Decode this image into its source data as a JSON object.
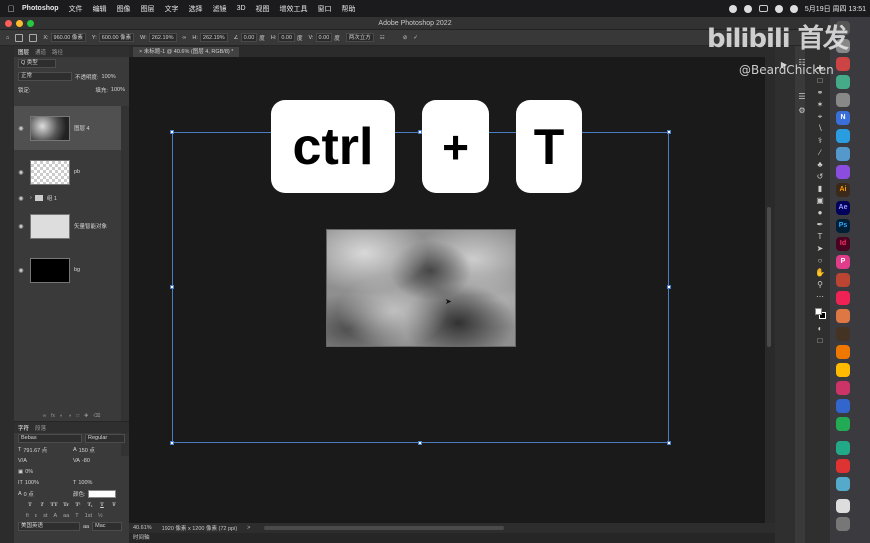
{
  "menubar": {
    "items": [
      "Photoshop",
      "文件",
      "编辑",
      "图像",
      "图层",
      "文字",
      "选择",
      "滤镜",
      "3D",
      "视图",
      "增效工具",
      "窗口",
      "帮助"
    ],
    "datetime": "5月19日 周四  13:51"
  },
  "window": {
    "title": "Adobe Photoshop 2022"
  },
  "options": {
    "x_label": "X:",
    "x_value": "960.00 像素",
    "y_label": "Y:",
    "y_value": "600.00 像素",
    "w_label": "W:",
    "w_value": "262.19%",
    "h_label": "H:",
    "h_value": "262.19%",
    "rotate_value": "0.00",
    "rotate_unit": "度",
    "hskew_label": "H:",
    "hskew_value": "0.00",
    "hskew_unit": "度",
    "vskew_label": "V:",
    "vskew_value": "0.00",
    "vskew_unit": "度",
    "interpolation": "两次立方"
  },
  "document_tab": {
    "label": "未标题-1 @ 40.6% (图层 4, RGB/8) *"
  },
  "layers_panel": {
    "tabs": [
      "图层",
      "通道",
      "路径"
    ],
    "filter_label": "Q 类型",
    "blend_mode": "正常",
    "opacity_label": "不透明度:",
    "opacity_value": "100%",
    "lock_label": "锁定:",
    "fill_label": "填充:",
    "fill_value": "100%",
    "layers": [
      {
        "name": "图层 4"
      },
      {
        "name": "pb"
      },
      {
        "name": "组 1"
      },
      {
        "name": "矢量智能对象"
      },
      {
        "name": "bg"
      }
    ]
  },
  "character_panel": {
    "tabs": [
      "字符",
      "段落"
    ],
    "font_family": "Bebas",
    "font_style": "Regular",
    "font_size": "791.67 点",
    "leading": "150 点",
    "tracking": "-80",
    "scale_pct": "0%",
    "vscale": "100%",
    "hscale": "100%",
    "baseline": "0 点",
    "color_label": "颜色:",
    "language": "美国英语",
    "aa": "Mac",
    "style_buttons": [
      "T",
      "T",
      "TT",
      "Tr",
      "T¹",
      "T₁",
      "T",
      "Ŧ"
    ]
  },
  "overlay_keys": {
    "key1": "ctrl",
    "plus": "+",
    "key2": "T"
  },
  "status": {
    "zoom": "40.61%",
    "doc_info": "1920 像素 x 1200 像素 (72 ppi)",
    "arrow": ">"
  },
  "timeline": {
    "label": "时间轴"
  },
  "watermark": {
    "logo": "bilibili 首发",
    "handle": "@BeardChicken"
  },
  "colors": {
    "selection": "#4a7dc4",
    "canvas_bg": "#1a1a1a",
    "panel_bg": "#3a3a3a"
  },
  "icons": [
    "apple-icon",
    "home-icon",
    "move-tool-icon",
    "eye-icon",
    "folder-icon",
    "cancel-icon",
    "commit-check-icon"
  ]
}
